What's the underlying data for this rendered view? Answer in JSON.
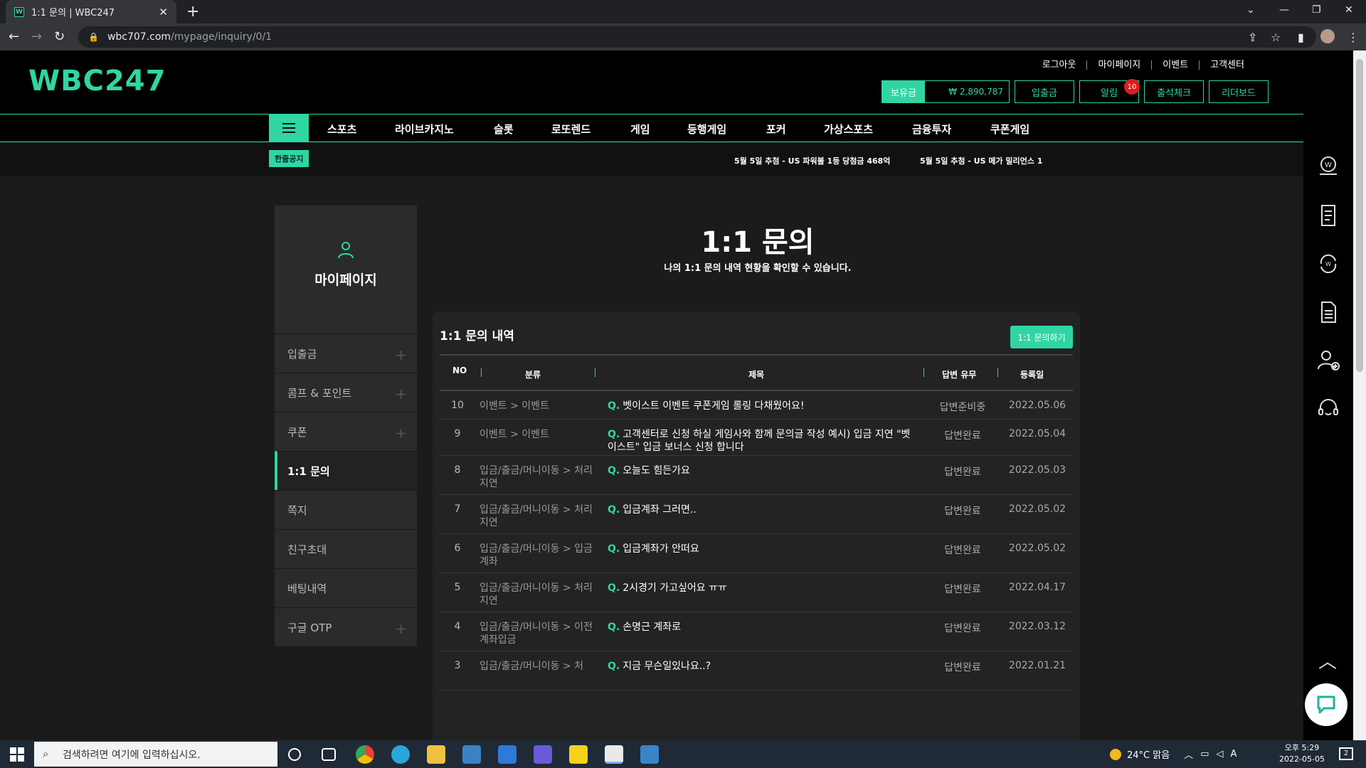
{
  "browser": {
    "tab_title": "1:1 문의 | WBC247",
    "tab_favicon_letter": "W",
    "url_host": "wbc707.com",
    "url_path": "/mypage/inquiry/0/1"
  },
  "header": {
    "logo": "WBC247",
    "top_links": [
      "로그아웃",
      "마이페이지",
      "이벤트",
      "고객센터"
    ],
    "balance_label": "보유금",
    "balance_value": "₩ 2,890,787",
    "buttons": {
      "deposit": "입출금",
      "notice": "알림",
      "notice_count": "10",
      "attendance": "출석체크",
      "leaderboard": "리더보드"
    }
  },
  "nav": {
    "items": [
      "스포츠",
      "라이브카지노",
      "슬롯",
      "로또렌드",
      "게임",
      "등행게임",
      "포커",
      "가상스포츠",
      "금융투자",
      "쿠폰게임"
    ]
  },
  "ticker": {
    "tag": "한줄공지",
    "items": [
      "5월 5일 추첨 - US 파워볼 1등 당첨금 468억",
      "5월 5일 추첨 - US 메가 밀리언스 1"
    ]
  },
  "sidebar": {
    "title": "마이페이지",
    "items": [
      {
        "label": "입출금",
        "expandable": true
      },
      {
        "label": "콤프 & 포인트",
        "expandable": true
      },
      {
        "label": "쿠폰",
        "expandable": true
      },
      {
        "label": "1:1 문의",
        "active": true
      },
      {
        "label": "쪽지"
      },
      {
        "label": "친구초대"
      },
      {
        "label": "베팅내역"
      },
      {
        "label": "구글 OTP",
        "expandable": true
      }
    ]
  },
  "main": {
    "title": "1:1 문의",
    "subtitle": "나의 1:1 문의 내역 현황을 확인할 수 있습니다.",
    "panel_title": "1:1 문의 내역",
    "ask_button": "1:1 문의하기",
    "columns": [
      "NO",
      "분류",
      "제목",
      "답변 유무",
      "등록일"
    ],
    "q_marker": "Q.",
    "rows": [
      {
        "no": "10",
        "category": "이벤트 > 이벤트",
        "title": "벳이스트 이벤트 쿠폰게임 롤링 다채웠어요!",
        "answer": "답변준비중",
        "date": "2022.05.06"
      },
      {
        "no": "9",
        "category": "이벤트 > 이벤트",
        "title": "고객센터로 신청 하실 게임사와 함께 문의글 작성 예시) 입금 지연 \"벳이스트\" 입금 보너스 신청 합니다",
        "answer": "답변완료",
        "date": "2022.05.04"
      },
      {
        "no": "8",
        "category": "입금/출금/머니이동 > 처리지연",
        "title": "오늘도 힘든가요",
        "answer": "답변완료",
        "date": "2022.05.03"
      },
      {
        "no": "7",
        "category": "입금/출금/머니이동 > 처리지연",
        "title": "입금계좌 그러면..",
        "answer": "답변완료",
        "date": "2022.05.02"
      },
      {
        "no": "6",
        "category": "입금/출금/머니이동 > 입금계좌",
        "title": "입금계좌가 안떠요",
        "answer": "답변완료",
        "date": "2022.05.02"
      },
      {
        "no": "5",
        "category": "입금/출금/머니이동 > 처리지연",
        "title": "2시경기 가고싶어요 ㅠㅠ",
        "answer": "답변완료",
        "date": "2022.04.17"
      },
      {
        "no": "4",
        "category": "입금/출금/머니이동 > 이전계좌입금",
        "title": "손명근 계좌로",
        "answer": "답변완료",
        "date": "2022.03.12"
      },
      {
        "no": "3",
        "category": "입금/출금/머니이동 > 처",
        "title": "지금 무슨일있나요..?",
        "answer": "답변완료",
        "date": "2022.01.21"
      }
    ]
  },
  "rail_icons": [
    "wallet-icon",
    "receipt-icon",
    "exchange-icon",
    "document-icon",
    "add-user-icon",
    "support-icon"
  ],
  "taskbar": {
    "search_placeholder": "검색하려면 여기에 입력하십시오.",
    "weather": "24°C 맑음",
    "ime": "A",
    "time": "오후 5:29",
    "date": "2022-05-05",
    "notif_count": "2"
  },
  "colors": {
    "accent": "#2fd6a4",
    "background": "#1b1b1b",
    "badge": "#e01b1b"
  }
}
